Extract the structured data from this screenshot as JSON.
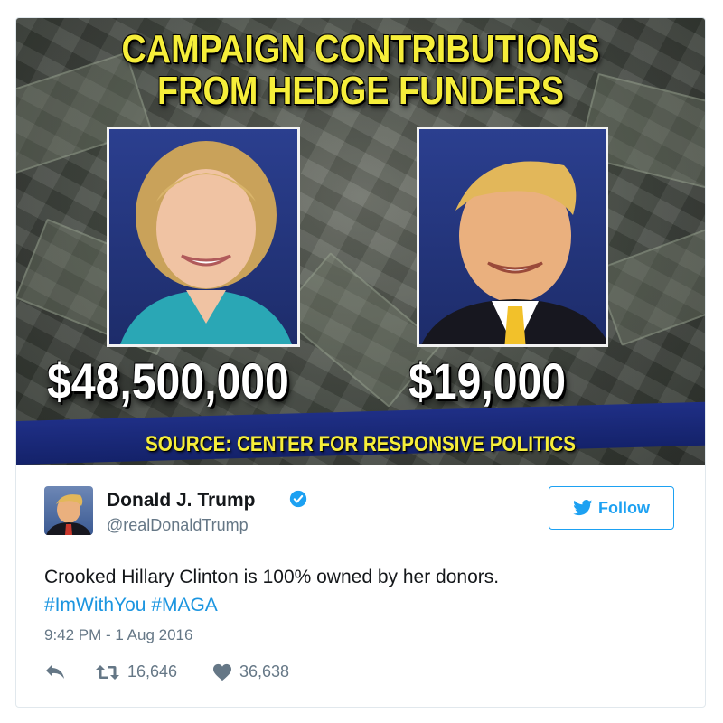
{
  "media": {
    "headline_line1": "CAMPAIGN CONTRIBUTIONS",
    "headline_line2": "FROM HEDGE FUNDERS",
    "left_amount": "$48,500,000",
    "right_amount": "$19,000",
    "source": "SOURCE: CENTER FOR RESPONSIVE POLITICS",
    "colors": {
      "headline": "#f6ee3a",
      "band": "#1f2f86"
    }
  },
  "tweet": {
    "author_name": "Donald J. Trump",
    "author_handle": "@realDonaldTrump",
    "verified_icon": "verified-check-icon",
    "follow_label": "Follow",
    "text": "Crooked Hillary Clinton is 100% owned by her donors.",
    "hashtags": [
      "#ImWithYou",
      "#MAGA"
    ],
    "timestamp": "9:42 PM - 1 Aug 2016",
    "actions": {
      "reply_icon": "reply-icon",
      "retweet_icon": "retweet-icon",
      "retweet_count": "16,646",
      "like_icon": "heart-icon",
      "like_count": "36,638"
    },
    "colors": {
      "accent": "#1da1f2",
      "hashtag": "#1b95e0",
      "muted": "#657786"
    }
  }
}
